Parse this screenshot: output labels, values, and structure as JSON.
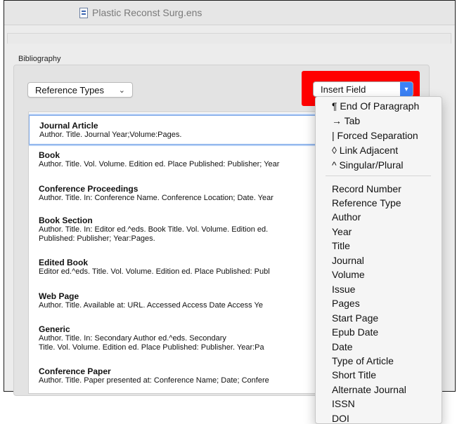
{
  "window": {
    "title": "Plastic Reconst Surg.ens"
  },
  "bibliography": {
    "label": "Bibliography",
    "reference_types_label": "Reference Types",
    "insert_field_label": "Insert Field"
  },
  "reference_items": [
    {
      "title": "Journal Article",
      "format": "Author. Title. Journal Year;Volume:Pages."
    },
    {
      "title": "Book",
      "format": "Author. Title. Vol. Volume. Edition ed. Place Published: Publisher; Year"
    },
    {
      "title": "Conference Proceedings",
      "format": "Author. Title. In: Conference Name. Conference Location; Date. Year"
    },
    {
      "title": "Book Section",
      "format": "Author. Title. In: Editor ed.^eds. Book Title. Vol. Volume. Edition ed.",
      "format2": "Published: Publisher; Year:Pages."
    },
    {
      "title": "Edited Book",
      "format": "Editor ed.^eds. Title. Vol. Volume. Edition ed. Place Published: Publ"
    },
    {
      "title": "Web Page",
      "format": "Author. Title. Available at: URL. Accessed Access Date Access Ye"
    },
    {
      "title": "Generic",
      "format": "Author. Title. In: Secondary Author ed.^eds. Secondary",
      "format2": "Title. Vol. Volume. Edition ed. Place Published: Publisher. Year:Pa"
    },
    {
      "title": "Conference Paper",
      "format": "Author. Title. Paper presented at: Conference Name; Date; Confere"
    }
  ],
  "insert_field_menu": {
    "group1": [
      "¶ End Of Paragraph",
      "→ Tab",
      "| Forced Separation",
      "◊ Link Adjacent",
      "^ Singular/Plural"
    ],
    "group2": [
      "Record Number",
      "Reference Type",
      "Author",
      "Year",
      "Title",
      "Journal",
      "Volume",
      "Issue",
      "Pages",
      "Start Page",
      "Epub Date",
      "Date",
      "Type of Article",
      "Short Title",
      "Alternate Journal",
      "ISSN",
      "DOI"
    ]
  },
  "colors": {
    "highlight": "#ff0000",
    "accent": "#3b82f6"
  }
}
